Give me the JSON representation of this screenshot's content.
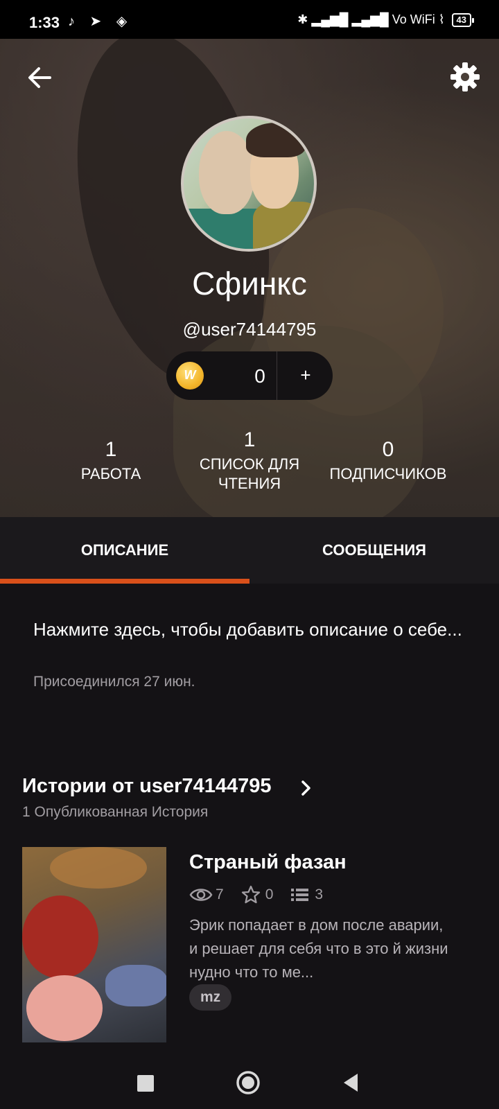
{
  "status_bar": {
    "time": "1:33",
    "app_icons": "♪ ➤ ◈",
    "network": "✱ ▂▄▆█ ▂▄▆█ Vo WiFi ⌇",
    "battery": "43"
  },
  "profile": {
    "display_name": "Сфинкс",
    "username": "@user74144795",
    "coins": {
      "count": "0",
      "add_label": "+",
      "coin_symbol": "W"
    },
    "stats": [
      {
        "value": "1",
        "label": "РАБОТА"
      },
      {
        "value": "1",
        "label": "СПИСОК ДЛЯ ЧТЕНИЯ"
      },
      {
        "value": "0",
        "label": "ПОДПИСЧИКОВ"
      }
    ]
  },
  "tabs": [
    {
      "label": "ОПИСАНИЕ",
      "active": true
    },
    {
      "label": "СООБЩЕНИЯ",
      "active": false
    }
  ],
  "about": {
    "description_placeholder": "Нажмите здесь, чтобы добавить описание о себе...",
    "joined": "Присоединился 27 июн."
  },
  "stories_section": {
    "title": "Истории от user74144795",
    "subtitle": "1 Опубликованная История",
    "items": [
      {
        "title": "Страный фазан",
        "views": "7",
        "votes": "0",
        "parts": "3",
        "description": "Эрик попадает в дом после аварии, и решает для себя что в это й жизни нудно что то ме...",
        "tag": "mz"
      }
    ]
  },
  "colors": {
    "accent": "#d9501a",
    "background": "#141215",
    "tab_bar": "#1b191c",
    "muted_text": "#a29ea3"
  },
  "icons": {
    "back": "arrow-left-icon",
    "settings": "gear-icon",
    "views": "eye-icon",
    "votes": "star-icon",
    "parts": "list-icon",
    "chevron": "chevron-right-icon"
  }
}
